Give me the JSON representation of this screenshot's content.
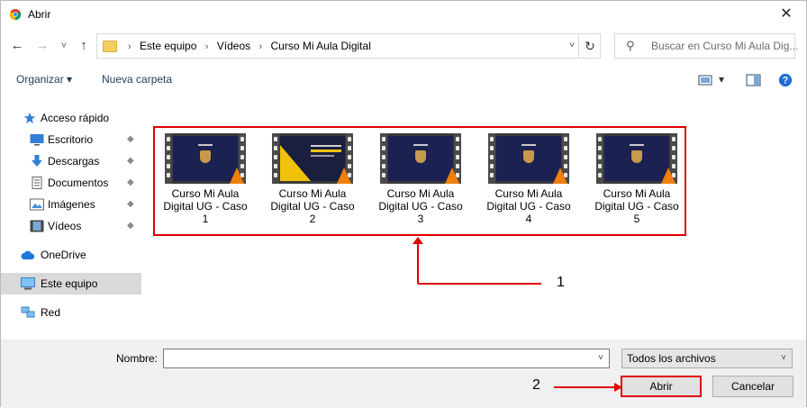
{
  "window": {
    "title": "Abrir",
    "close_glyph": "✕"
  },
  "nav": {
    "back_glyph": "←",
    "forward_glyph": "→",
    "recent_glyph": "˅",
    "up_glyph": "↑",
    "breadcrumbs": [
      "Este equipo",
      "Vídeos",
      "Curso Mi Aula Digital"
    ],
    "crumb_separator": "›",
    "refresh_glyph": "↻",
    "dropdown_glyph": "˅",
    "search_placeholder": "Buscar en Curso Mi Aula Dig...",
    "search_glyph": "⚲"
  },
  "toolbar": {
    "organize_label": "Organizar ▾",
    "new_folder_label": "Nueva carpeta",
    "view_dropdown_glyph": "▾",
    "help_glyph": "?"
  },
  "sidebar": {
    "items": [
      {
        "label": "Acceso rápido",
        "icon": "star-icon",
        "pinned": false,
        "selected": false
      },
      {
        "label": "Escritorio",
        "icon": "desktop-icon",
        "pinned": true,
        "selected": false
      },
      {
        "label": "Descargas",
        "icon": "download-icon",
        "pinned": true,
        "selected": false
      },
      {
        "label": "Documentos",
        "icon": "document-icon",
        "pinned": true,
        "selected": false
      },
      {
        "label": "Imágenes",
        "icon": "image-icon",
        "pinned": true,
        "selected": false
      },
      {
        "label": "Vídeos",
        "icon": "video-icon",
        "pinned": true,
        "selected": false
      },
      {
        "label": "OneDrive",
        "icon": "cloud-icon",
        "pinned": false,
        "selected": false
      },
      {
        "label": "Este equipo",
        "icon": "computer-icon",
        "pinned": false,
        "selected": true
      },
      {
        "label": "Red",
        "icon": "network-icon",
        "pinned": false,
        "selected": false
      }
    ],
    "pin_glyph": "📌"
  },
  "files": [
    {
      "line1": "Curso Mi Aula",
      "line2": "Digital UG - Caso",
      "line3": "1"
    },
    {
      "line1": "Curso Mi Aula",
      "line2": "Digital UG - Caso",
      "line3": "2"
    },
    {
      "line1": "Curso Mi Aula",
      "line2": "Digital UG - Caso",
      "line3": "3"
    },
    {
      "line1": "Curso Mi Aula",
      "line2": "Digital UG - Caso",
      "line3": "4"
    },
    {
      "line1": "Curso Mi Aula",
      "line2": "Digital UG - Caso",
      "line3": "5"
    }
  ],
  "annotations": {
    "label_1": "1",
    "label_2": "2",
    "color": "#e00000"
  },
  "bottom": {
    "name_label": "Nombre:",
    "name_value": "",
    "dropdown_glyph": "˅",
    "filter_value": "Todos los archivos",
    "open_label": "Abrir",
    "cancel_label": "Cancelar"
  },
  "colors": {
    "selected_bg": "#d9d9d9",
    "footer_bg": "#f0f0f0",
    "link_text": "#1f3b5a",
    "vlc_orange": "#f07f0b",
    "yellow_accent": "#f2c10a"
  }
}
